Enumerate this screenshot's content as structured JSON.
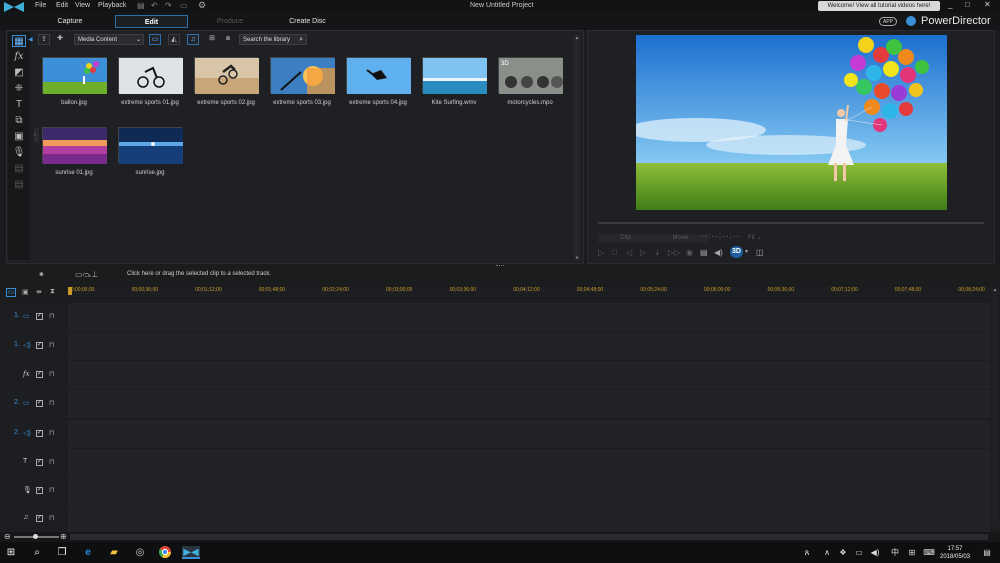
{
  "menu": [
    "File",
    "Edit",
    "View",
    "Playback"
  ],
  "window_title": "New Untitled Project",
  "notification": "Welcome! View all tutorial videos here!",
  "tabs": [
    {
      "label": "Capture",
      "state": "normal"
    },
    {
      "label": "Edit",
      "state": "active"
    },
    {
      "label": "Produce",
      "state": "disabled"
    },
    {
      "label": "Create Disc",
      "state": "normal"
    }
  ],
  "brand": {
    "app_badge": "APP",
    "name": "PowerDirector"
  },
  "library": {
    "filter": "Media Content",
    "search_placeholder": "Search the library",
    "items": [
      {
        "name": "ballon.jpg",
        "kind": "balloons"
      },
      {
        "name": "extreme sports 01.jpg",
        "kind": "bmx"
      },
      {
        "name": "extreme sports 02.jpg",
        "kind": "moto"
      },
      {
        "name": "extreme sports 03.jpg",
        "kind": "sunset"
      },
      {
        "name": "extreme sports 04.jpg",
        "kind": "sky"
      },
      {
        "name": "Kite Surfing.wmv",
        "kind": "sea"
      },
      {
        "name": "motorcycles.mpo",
        "kind": "bikes"
      },
      {
        "name": "sunrise 01.jpg",
        "kind": "purple"
      },
      {
        "name": "sunrise.jpg",
        "kind": "blue"
      }
    ]
  },
  "preview": {
    "clip": "Clip",
    "movie": "Movie",
    "timecode": "- - ; - - ; - - ; - -",
    "fit": "Fit"
  },
  "timeline": {
    "hint": "Click here or drag the selected clip to a selected track.",
    "ticks": [
      "00;00;00;00",
      "00;00;36;00",
      "00;01;12;00",
      "00;01;48;00",
      "00;02;24;00",
      "00;03;00;00",
      "00;03;36;00",
      "00;04;12;00",
      "00;04;48;00",
      "00;05;24;00",
      "00;06;00;00",
      "00;06;36;00",
      "00;07;12;00",
      "00;07;48;00",
      "00;08;24;00"
    ],
    "tracks": [
      {
        "label": "1.",
        "icon": "video"
      },
      {
        "label": "1.",
        "icon": "audio"
      },
      {
        "label": "",
        "icon": "fx"
      },
      {
        "label": "2.",
        "icon": "video"
      },
      {
        "label": "2.",
        "icon": "audio"
      },
      {
        "label": "",
        "icon": "title"
      },
      {
        "label": "",
        "icon": "voice"
      },
      {
        "label": "",
        "icon": "music"
      }
    ]
  },
  "clock": {
    "time": "17:57",
    "date": "2018/05/03"
  },
  "accent": "#3a8fd8"
}
